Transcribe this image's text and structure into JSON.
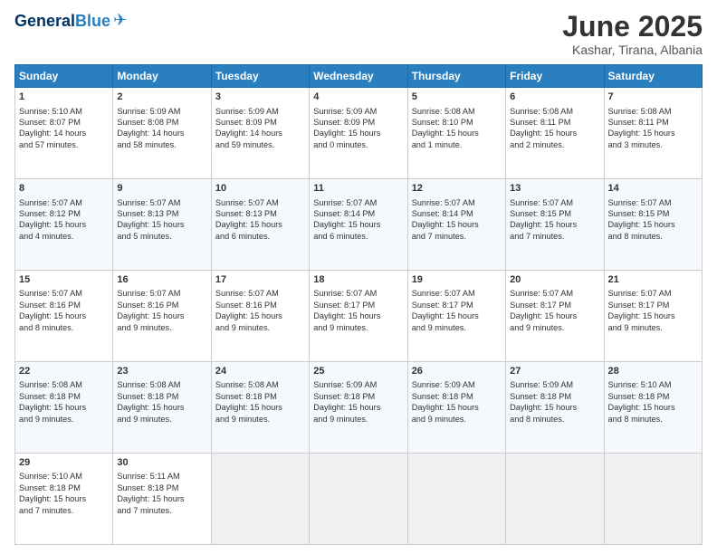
{
  "header": {
    "logo_general": "General",
    "logo_blue": "Blue",
    "month_title": "June 2025",
    "location": "Kashar, Tirana, Albania"
  },
  "days_of_week": [
    "Sunday",
    "Monday",
    "Tuesday",
    "Wednesday",
    "Thursday",
    "Friday",
    "Saturday"
  ],
  "weeks": [
    [
      {
        "day": "1",
        "info": "Sunrise: 5:10 AM\nSunset: 8:07 PM\nDaylight: 14 hours\nand 57 minutes."
      },
      {
        "day": "2",
        "info": "Sunrise: 5:09 AM\nSunset: 8:08 PM\nDaylight: 14 hours\nand 58 minutes."
      },
      {
        "day": "3",
        "info": "Sunrise: 5:09 AM\nSunset: 8:09 PM\nDaylight: 14 hours\nand 59 minutes."
      },
      {
        "day": "4",
        "info": "Sunrise: 5:09 AM\nSunset: 8:09 PM\nDaylight: 15 hours\nand 0 minutes."
      },
      {
        "day": "5",
        "info": "Sunrise: 5:08 AM\nSunset: 8:10 PM\nDaylight: 15 hours\nand 1 minute."
      },
      {
        "day": "6",
        "info": "Sunrise: 5:08 AM\nSunset: 8:11 PM\nDaylight: 15 hours\nand 2 minutes."
      },
      {
        "day": "7",
        "info": "Sunrise: 5:08 AM\nSunset: 8:11 PM\nDaylight: 15 hours\nand 3 minutes."
      }
    ],
    [
      {
        "day": "8",
        "info": "Sunrise: 5:07 AM\nSunset: 8:12 PM\nDaylight: 15 hours\nand 4 minutes."
      },
      {
        "day": "9",
        "info": "Sunrise: 5:07 AM\nSunset: 8:13 PM\nDaylight: 15 hours\nand 5 minutes."
      },
      {
        "day": "10",
        "info": "Sunrise: 5:07 AM\nSunset: 8:13 PM\nDaylight: 15 hours\nand 6 minutes."
      },
      {
        "day": "11",
        "info": "Sunrise: 5:07 AM\nSunset: 8:14 PM\nDaylight: 15 hours\nand 6 minutes."
      },
      {
        "day": "12",
        "info": "Sunrise: 5:07 AM\nSunset: 8:14 PM\nDaylight: 15 hours\nand 7 minutes."
      },
      {
        "day": "13",
        "info": "Sunrise: 5:07 AM\nSunset: 8:15 PM\nDaylight: 15 hours\nand 7 minutes."
      },
      {
        "day": "14",
        "info": "Sunrise: 5:07 AM\nSunset: 8:15 PM\nDaylight: 15 hours\nand 8 minutes."
      }
    ],
    [
      {
        "day": "15",
        "info": "Sunrise: 5:07 AM\nSunset: 8:16 PM\nDaylight: 15 hours\nand 8 minutes."
      },
      {
        "day": "16",
        "info": "Sunrise: 5:07 AM\nSunset: 8:16 PM\nDaylight: 15 hours\nand 9 minutes."
      },
      {
        "day": "17",
        "info": "Sunrise: 5:07 AM\nSunset: 8:16 PM\nDaylight: 15 hours\nand 9 minutes."
      },
      {
        "day": "18",
        "info": "Sunrise: 5:07 AM\nSunset: 8:17 PM\nDaylight: 15 hours\nand 9 minutes."
      },
      {
        "day": "19",
        "info": "Sunrise: 5:07 AM\nSunset: 8:17 PM\nDaylight: 15 hours\nand 9 minutes."
      },
      {
        "day": "20",
        "info": "Sunrise: 5:07 AM\nSunset: 8:17 PM\nDaylight: 15 hours\nand 9 minutes."
      },
      {
        "day": "21",
        "info": "Sunrise: 5:07 AM\nSunset: 8:17 PM\nDaylight: 15 hours\nand 9 minutes."
      }
    ],
    [
      {
        "day": "22",
        "info": "Sunrise: 5:08 AM\nSunset: 8:18 PM\nDaylight: 15 hours\nand 9 minutes."
      },
      {
        "day": "23",
        "info": "Sunrise: 5:08 AM\nSunset: 8:18 PM\nDaylight: 15 hours\nand 9 minutes."
      },
      {
        "day": "24",
        "info": "Sunrise: 5:08 AM\nSunset: 8:18 PM\nDaylight: 15 hours\nand 9 minutes."
      },
      {
        "day": "25",
        "info": "Sunrise: 5:09 AM\nSunset: 8:18 PM\nDaylight: 15 hours\nand 9 minutes."
      },
      {
        "day": "26",
        "info": "Sunrise: 5:09 AM\nSunset: 8:18 PM\nDaylight: 15 hours\nand 9 minutes."
      },
      {
        "day": "27",
        "info": "Sunrise: 5:09 AM\nSunset: 8:18 PM\nDaylight: 15 hours\nand 8 minutes."
      },
      {
        "day": "28",
        "info": "Sunrise: 5:10 AM\nSunset: 8:18 PM\nDaylight: 15 hours\nand 8 minutes."
      }
    ],
    [
      {
        "day": "29",
        "info": "Sunrise: 5:10 AM\nSunset: 8:18 PM\nDaylight: 15 hours\nand 7 minutes."
      },
      {
        "day": "30",
        "info": "Sunrise: 5:11 AM\nSunset: 8:18 PM\nDaylight: 15 hours\nand 7 minutes."
      },
      {
        "day": "",
        "info": ""
      },
      {
        "day": "",
        "info": ""
      },
      {
        "day": "",
        "info": ""
      },
      {
        "day": "",
        "info": ""
      },
      {
        "day": "",
        "info": ""
      }
    ]
  ]
}
